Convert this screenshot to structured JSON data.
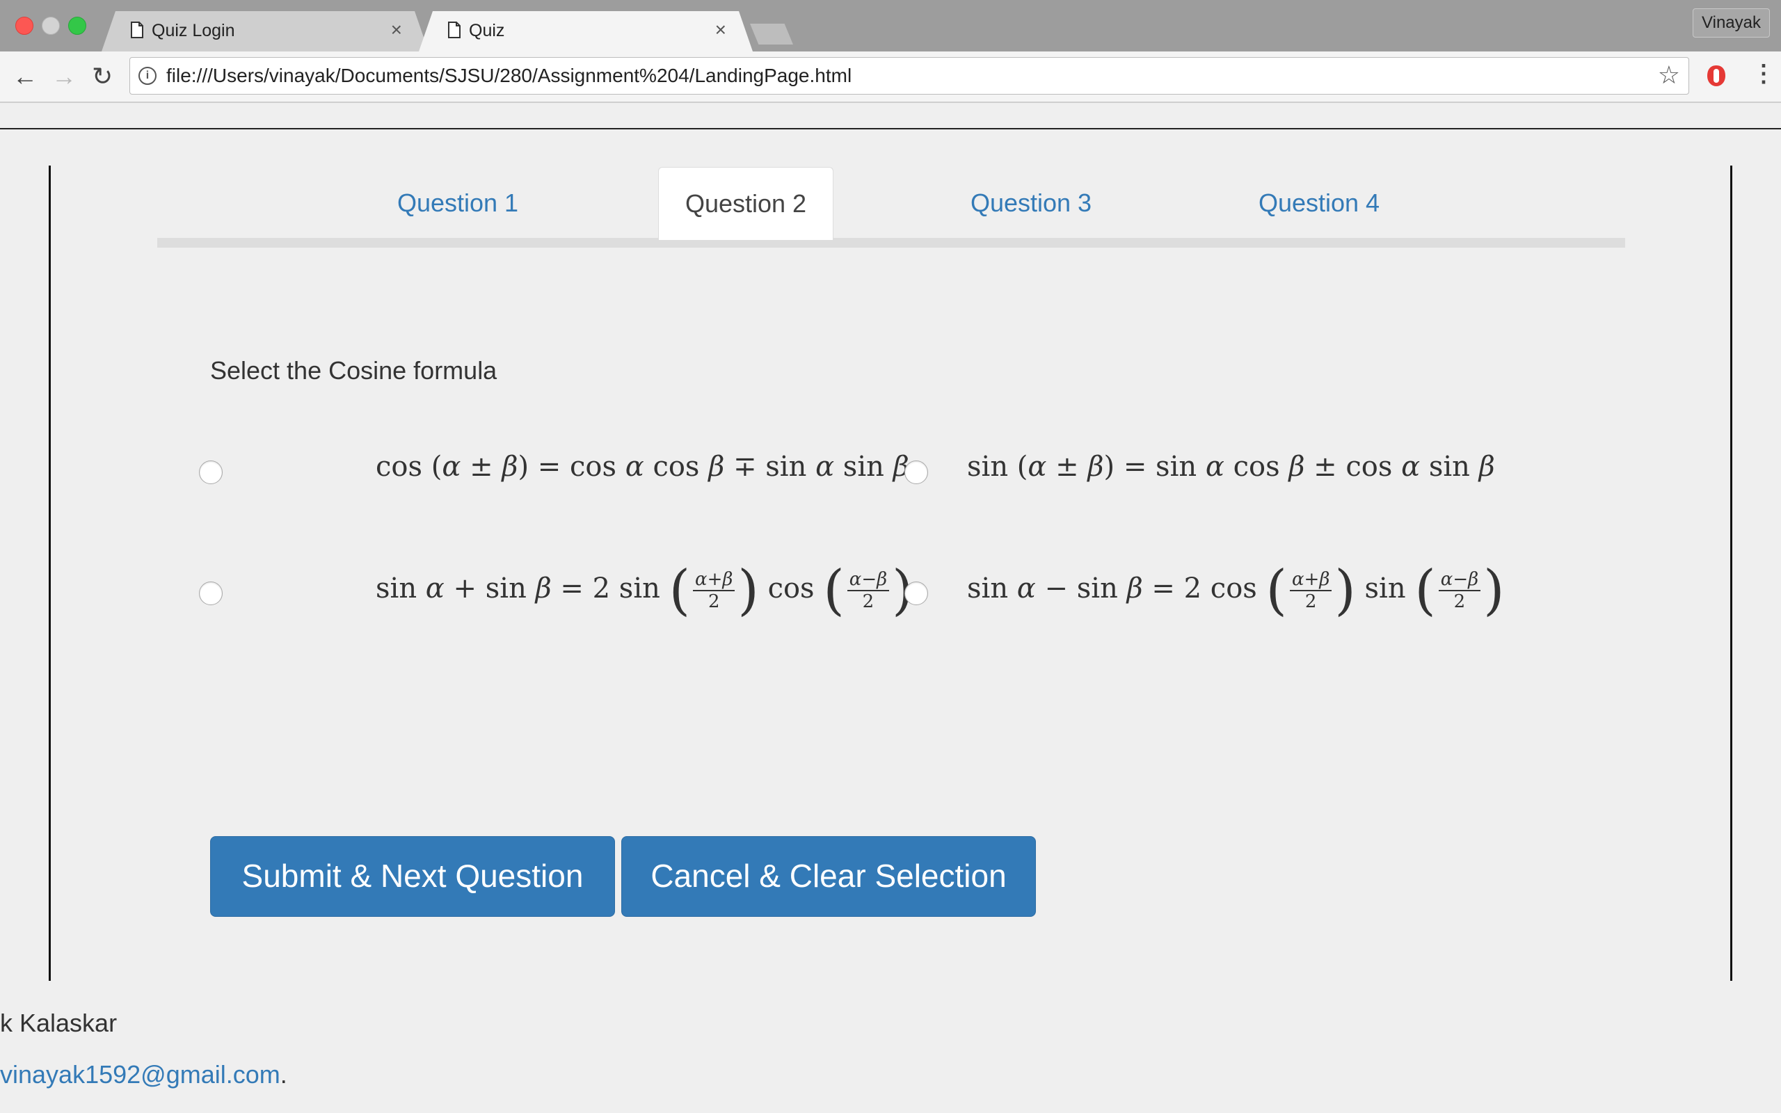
{
  "browser": {
    "tabs": [
      {
        "title": "Quiz Login",
        "active": false
      },
      {
        "title": "Quiz",
        "active": true
      }
    ],
    "profile": "Vinayak",
    "url": "file:///Users/vinayak/Documents/SJSU/280/Assignment%204/LandingPage.html"
  },
  "quiz": {
    "tabs": [
      "Question 1",
      "Question 2",
      "Question 3",
      "Question 4"
    ],
    "active_tab": "Question 2",
    "prompt": "Select the Cosine formula",
    "options": [
      "cos (α ± β) = cos α cos β ∓ sin α sin β",
      "sin (α ± β) = sin α cos β ± cos α sin β",
      "sin α + sin β = 2 sin ((α+β)/2) cos ((α−β)/2)",
      "sin α − sin β = 2 cos ((α+β)/2) sin ((α−β)/2)"
    ],
    "submit_label": "Submit & Next Question",
    "cancel_label": "Cancel & Clear Selection"
  },
  "footer": {
    "name": "k Kalaskar",
    "email": "vinayak1592@gmail.com",
    "email_suffix": "."
  },
  "colors": {
    "link": "#337ab7",
    "button": "#337ab7"
  }
}
